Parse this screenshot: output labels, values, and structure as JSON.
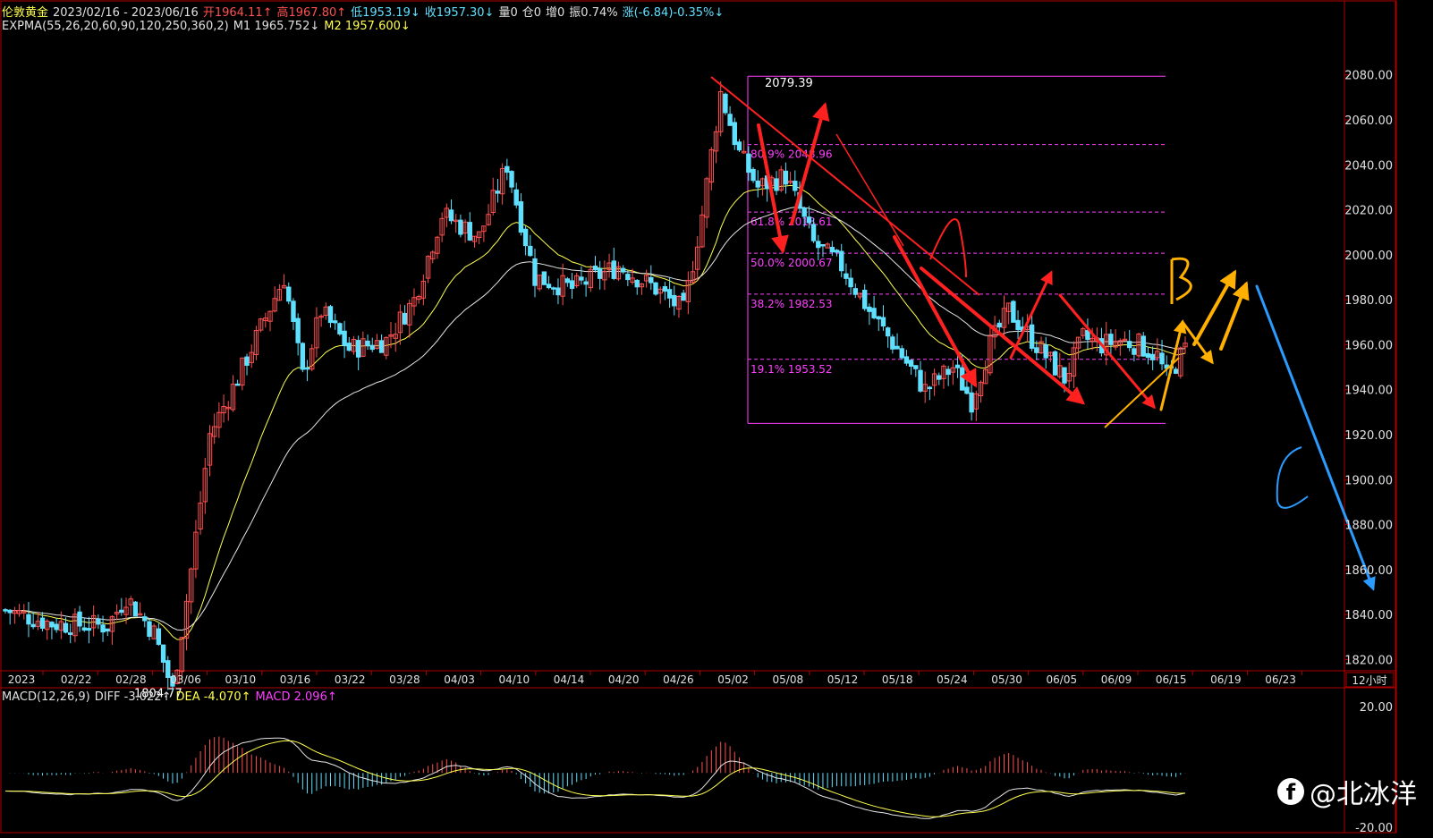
{
  "header": {
    "row1": [
      {
        "text": "伦敦黄金",
        "color": "#ffff4d"
      },
      {
        "text": "2023/02/16 - 2023/06/16",
        "color": "#e0e0e0"
      },
      {
        "text": "开1964.11↑",
        "color": "#ff5050"
      },
      {
        "text": "高1967.80↑",
        "color": "#ff5050"
      },
      {
        "text": "低1953.19↓",
        "color": "#5fe0ff"
      },
      {
        "text": "收1957.30↓",
        "color": "#5fe0ff"
      },
      {
        "text": "量0",
        "color": "#e0e0e0"
      },
      {
        "text": "仓0",
        "color": "#e0e0e0"
      },
      {
        "text": "增0",
        "color": "#e0e0e0"
      },
      {
        "text": "振0.74%",
        "color": "#e0e0e0"
      },
      {
        "text": "涨(-6.84)-0.35%↓",
        "color": "#5fe0ff"
      }
    ],
    "row2": [
      {
        "text": "EXPMA(55,26,20,60,90,120,250,360,2)",
        "color": "#e0e0e0"
      },
      {
        "text": "M1 1965.752↓",
        "color": "#e0e0e0"
      },
      {
        "text": "M2 1957.600↓",
        "color": "#ffff4d"
      }
    ],
    "macd": [
      {
        "text": "MACD(12,26,9)",
        "color": "#e0e0e0"
      },
      {
        "text": "DIFF -3.022↑",
        "color": "#e0e0e0"
      },
      {
        "text": "DEA -4.070↑",
        "color": "#ffff4d"
      },
      {
        "text": "MACD 2.096↑",
        "color": "#ff40ff"
      }
    ]
  },
  "watermark": {
    "icon": "facebook-icon",
    "text": "@北冰洋"
  },
  "chart_data": [
    {
      "type": "candlestick",
      "title": "伦敦黄金",
      "period_label": "12小时",
      "x_tick_labels": [
        "2023",
        "02/22",
        "02/28",
        "03/06",
        "03/10",
        "03/16",
        "03/22",
        "03/28",
        "04/03",
        "04/10",
        "04/14",
        "04/20",
        "04/26",
        "05/02",
        "05/08",
        "05/12",
        "05/18",
        "05/24",
        "05/30",
        "06/05",
        "06/09",
        "06/15",
        "06/19",
        "06/23"
      ],
      "y_tick_labels": [
        "2080.00",
        "2060.00",
        "2040.00",
        "2020.00",
        "2000.00",
        "1980.00",
        "1960.00",
        "1940.00",
        "1920.00",
        "1900.00",
        "1880.00",
        "1860.00",
        "1840.00",
        "1820.00"
      ],
      "ylim": [
        1815,
        2095
      ],
      "colors": {
        "up": "#ff5050",
        "down": "#5fe0ff",
        "ema_fast": "#ffff4d",
        "ema_slow": "#e6e6e6",
        "fib": "#ff40ff"
      },
      "candles_count": 220,
      "price_path": [
        [
          0,
          1842
        ],
        [
          10,
          1836
        ],
        [
          22,
          1835
        ],
        [
          26,
          1848
        ],
        [
          32,
          1832
        ],
        [
          36,
          1806
        ],
        [
          40,
          1860
        ],
        [
          44,
          1920
        ],
        [
          50,
          1945
        ],
        [
          56,
          1972
        ],
        [
          60,
          1990
        ],
        [
          64,
          1946
        ],
        [
          68,
          1975
        ],
        [
          74,
          1958
        ],
        [
          82,
          1962
        ],
        [
          88,
          1980
        ],
        [
          94,
          2018
        ],
        [
          102,
          2008
        ],
        [
          108,
          2040
        ],
        [
          114,
          1990
        ],
        [
          122,
          1985
        ],
        [
          132,
          1995
        ],
        [
          140,
          1985
        ],
        [
          146,
          1975
        ],
        [
          150,
          2018
        ],
        [
          154,
          2072
        ],
        [
          158,
          2045
        ],
        [
          162,
          2030
        ],
        [
          168,
          2035
        ],
        [
          174,
          2005
        ],
        [
          180,
          1995
        ],
        [
          186,
          1975
        ],
        [
          192,
          1958
        ],
        [
          198,
          1940
        ],
        [
          204,
          1950
        ],
        [
          208,
          1935
        ],
        [
          212,
          1960
        ],
        [
          216,
          1975
        ],
        [
          222,
          1960
        ],
        [
          228,
          1945
        ],
        [
          232,
          1963
        ],
        [
          236,
          1960
        ],
        [
          240,
          1962
        ],
        [
          244,
          1960
        ],
        [
          248,
          1955
        ],
        [
          250,
          1945
        ],
        [
          254,
          1958
        ]
      ],
      "ema_fast_label": "M2 1957.600",
      "ema_slow_label": "M1 1965.752",
      "annotations": {
        "high_label": "2079.39",
        "low_label": "1804.77",
        "fib_levels": [
          {
            "label": "80.9% 2048.96",
            "value": 2049
          },
          {
            "label": "61.8% 2018.61",
            "value": 2019
          },
          {
            "label": "50.0% 2000.67",
            "value": 2000.67
          },
          {
            "label": "38.2% 1982.53",
            "value": 1982.5
          },
          {
            "label": "19.1% 1953.52",
            "value": 1953.5
          }
        ],
        "fib_range": [
          1925,
          2079.39
        ],
        "handwritten": [
          "B",
          "C"
        ]
      }
    },
    {
      "type": "bar",
      "title": "MACD(12,26,9)",
      "y_tick_labels": [
        "20.00",
        "-20.00"
      ],
      "ylim": [
        -20,
        20
      ],
      "series": [
        {
          "name": "DIFF",
          "last": -3.022,
          "color": "#e6e6e6"
        },
        {
          "name": "DEA",
          "last": -4.07,
          "color": "#ffff4d"
        },
        {
          "name": "MACD",
          "last": 2.096,
          "color": "#ff40ff"
        }
      ]
    }
  ]
}
